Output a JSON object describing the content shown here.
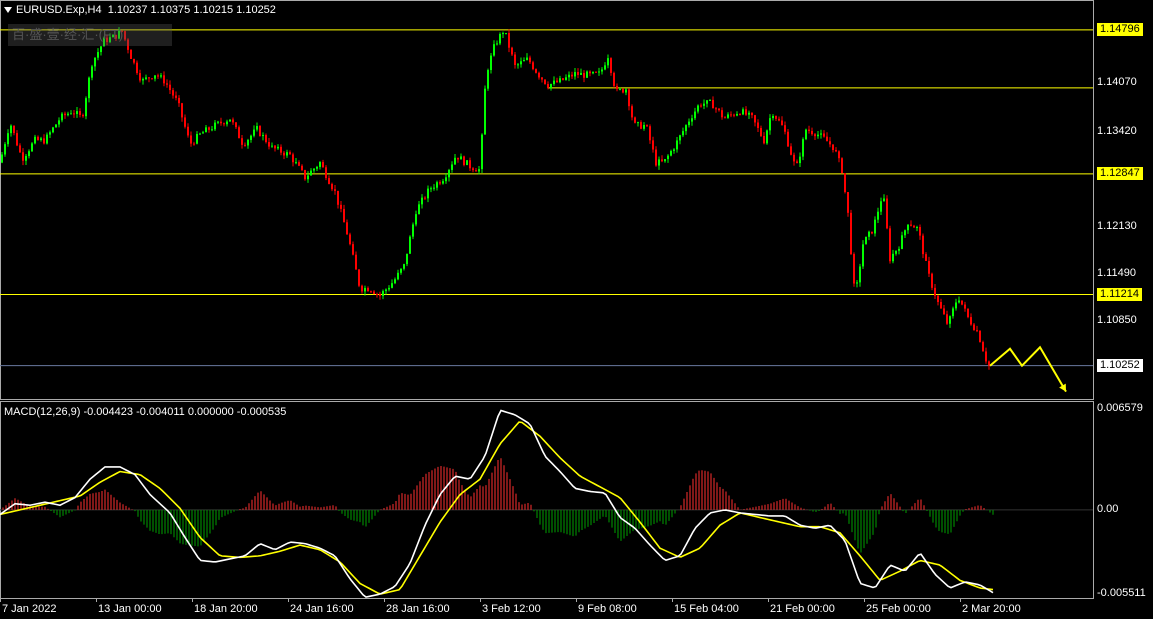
{
  "header": {
    "symbol": "EURUSD.Exp,H4",
    "ohlc": "1.10237 1.10375 1.10215 1.10252",
    "watermark": "百·盛·壹·经·汇·(FT)"
  },
  "macd_header": {
    "text": "MACD(12,26,9) -0.004423 -0.004011 0.000000 -0.000535"
  },
  "colors": {
    "bull": "#00ff00",
    "bear": "#ff0000",
    "level": "#ffff00",
    "macd_line": "#ffffff",
    "signal": "#ffff00",
    "hist_pos": "#ff3030",
    "hist_neg": "#00a000"
  },
  "chart_data": [
    {
      "type": "candlestick",
      "title": "EURUSD.Exp,H4",
      "ylim": [
        1.098,
        1.152
      ],
      "x_ticks": [
        "7 Jan 2022",
        "13 Jan 00:00",
        "18 Jan 20:00",
        "24 Jan 16:00",
        "28 Jan 16:00",
        "3 Feb 12:00",
        "9 Feb 08:00",
        "15 Feb 04:00",
        "21 Feb 00:00",
        "25 Feb 00:00",
        "2 Mar 20:00"
      ],
      "y_ticks": [
        1.1407,
        1.1342,
        1.1213,
        1.1149,
        1.1085
      ],
      "y_tick_labels": [
        "1.14070",
        "1.13420",
        "1.12130",
        "1.11490",
        "1.10850"
      ],
      "levels": [
        {
          "value": 1.14796,
          "label": "1.14796"
        },
        {
          "value": 1.12847,
          "label": "1.12847"
        },
        {
          "value": 1.11214,
          "label": "1.11214"
        }
      ],
      "segment_level": {
        "value": 1.1401
      },
      "current_price": {
        "value": 1.10252,
        "label": "1.10252"
      },
      "path_anchors": [
        [
          0,
          1.13
        ],
        [
          10,
          1.1355
        ],
        [
          22,
          1.1305
        ],
        [
          35,
          1.133
        ],
        [
          45,
          1.133
        ],
        [
          60,
          1.136
        ],
        [
          72,
          1.137
        ],
        [
          82,
          1.136
        ],
        [
          92,
          1.1435
        ],
        [
          104,
          1.1465
        ],
        [
          114,
          1.147
        ],
        [
          122,
          1.1478
        ],
        [
          132,
          1.144
        ],
        [
          142,
          1.141
        ],
        [
          155,
          1.142
        ],
        [
          165,
          1.141
        ],
        [
          178,
          1.138
        ],
        [
          190,
          1.1325
        ],
        [
          202,
          1.134
        ],
        [
          215,
          1.135
        ],
        [
          230,
          1.136
        ],
        [
          243,
          1.1325
        ],
        [
          257,
          1.1345
        ],
        [
          272,
          1.132
        ],
        [
          290,
          1.131
        ],
        [
          305,
          1.128
        ],
        [
          320,
          1.13
        ],
        [
          335,
          1.126
        ],
        [
          348,
          1.12
        ],
        [
          360,
          1.113
        ],
        [
          370,
          1.113
        ],
        [
          380,
          1.112
        ],
        [
          394,
          1.114
        ],
        [
          404,
          1.116
        ],
        [
          416,
          1.1235
        ],
        [
          430,
          1.1265
        ],
        [
          444,
          1.128
        ],
        [
          456,
          1.131
        ],
        [
          470,
          1.1295
        ],
        [
          480,
          1.129
        ],
        [
          486,
          1.142
        ],
        [
          495,
          1.146
        ],
        [
          504,
          1.148
        ],
        [
          515,
          1.143
        ],
        [
          528,
          1.144
        ],
        [
          538,
          1.142
        ],
        [
          548,
          1.1405
        ],
        [
          560,
          1.141
        ],
        [
          575,
          1.142
        ],
        [
          590,
          1.1418
        ],
        [
          600,
          1.142
        ],
        [
          608,
          1.1445
        ],
        [
          616,
          1.1395
        ],
        [
          626,
          1.14
        ],
        [
          634,
          1.135
        ],
        [
          646,
          1.135
        ],
        [
          656,
          1.13
        ],
        [
          664,
          1.13
        ],
        [
          678,
          1.133
        ],
        [
          690,
          1.136
        ],
        [
          700,
          1.138
        ],
        [
          712,
          1.138
        ],
        [
          724,
          1.136
        ],
        [
          740,
          1.137
        ],
        [
          752,
          1.136
        ],
        [
          764,
          1.133
        ],
        [
          772,
          1.137
        ],
        [
          784,
          1.1345
        ],
        [
          796,
          1.129
        ],
        [
          806,
          1.1345
        ],
        [
          816,
          1.134
        ],
        [
          826,
          1.133
        ],
        [
          834,
          1.132
        ],
        [
          842,
          1.129
        ],
        [
          848,
          1.123
        ],
        [
          855,
          1.1115
        ],
        [
          863,
          1.119
        ],
        [
          873,
          1.121
        ],
        [
          883,
          1.126
        ],
        [
          890,
          1.117
        ],
        [
          900,
          1.119
        ],
        [
          908,
          1.122
        ],
        [
          918,
          1.121
        ],
        [
          928,
          1.115
        ],
        [
          938,
          1.111
        ],
        [
          948,
          1.108
        ],
        [
          958,
          1.112
        ],
        [
          968,
          1.109
        ],
        [
          978,
          1.107
        ],
        [
          988,
          1.1025
        ]
      ],
      "projection": [
        [
          990,
          1.1025
        ],
        [
          1010,
          1.1048
        ],
        [
          1022,
          1.1025
        ],
        [
          1040,
          1.105
        ],
        [
          1066,
          1.099
        ]
      ]
    },
    {
      "type": "line",
      "title": "MACD(12,26,9)",
      "ylim": [
        -0.00575,
        0.0071
      ],
      "y_ticks": [
        0.006579,
        0.0,
        -0.005511
      ],
      "y_tick_labels": [
        "0.006579",
        "0.00",
        "-0.005511"
      ],
      "series": [
        {
          "name": "MACD",
          "anchors": [
            [
              0,
              -0.0003
            ],
            [
              15,
              0.0004
            ],
            [
              30,
              0.0003
            ],
            [
              45,
              0.0005
            ],
            [
              60,
              0.0003
            ],
            [
              75,
              0.0008
            ],
            [
              90,
              0.002
            ],
            [
              105,
              0.0028
            ],
            [
              120,
              0.0028
            ],
            [
              135,
              0.0023
            ],
            [
              150,
              0.001
            ],
            [
              170,
              -0.0002
            ],
            [
              185,
              -0.0018
            ],
            [
              200,
              -0.0033
            ],
            [
              215,
              -0.0034
            ],
            [
              230,
              -0.0032
            ],
            [
              245,
              -0.003
            ],
            [
              260,
              -0.0022
            ],
            [
              275,
              -0.0026
            ],
            [
              290,
              -0.0021
            ],
            [
              305,
              -0.0022
            ],
            [
              320,
              -0.0025
            ],
            [
              335,
              -0.003
            ],
            [
              350,
              -0.0045
            ],
            [
              365,
              -0.0057
            ],
            [
              380,
              -0.0055
            ],
            [
              395,
              -0.005
            ],
            [
              410,
              -0.0035
            ],
            [
              425,
              -0.001
            ],
            [
              440,
              0.001
            ],
            [
              455,
              0.0022
            ],
            [
              470,
              0.002
            ],
            [
              485,
              0.0035
            ],
            [
              500,
              0.0065
            ],
            [
              515,
              0.0062
            ],
            [
              530,
              0.0056
            ],
            [
              545,
              0.0035
            ],
            [
              560,
              0.0025
            ],
            [
              575,
              0.0014
            ],
            [
              590,
              0.0012
            ],
            [
              605,
              0.0011
            ],
            [
              620,
              -0.0005
            ],
            [
              635,
              -0.0012
            ],
            [
              650,
              -0.0023
            ],
            [
              665,
              -0.0033
            ],
            [
              680,
              -0.003
            ],
            [
              695,
              -0.0012
            ],
            [
              710,
              -0.0002
            ],
            [
              725,
              0.0
            ],
            [
              740,
              -0.0002
            ],
            [
              755,
              -0.0003
            ],
            [
              770,
              -0.0004
            ],
            [
              785,
              -0.0004
            ],
            [
              800,
              -0.001
            ],
            [
              815,
              -0.0012
            ],
            [
              830,
              -0.001
            ],
            [
              845,
              -0.002
            ],
            [
              860,
              -0.0048
            ],
            [
              875,
              -0.0051
            ],
            [
              890,
              -0.0036
            ],
            [
              905,
              -0.004
            ],
            [
              920,
              -0.0028
            ],
            [
              935,
              -0.0042
            ],
            [
              950,
              -0.0051
            ],
            [
              965,
              -0.0047
            ],
            [
              980,
              -0.0049
            ],
            [
              993,
              -0.0054
            ]
          ]
        },
        {
          "name": "Signal",
          "anchors": [
            [
              0,
              -0.0003
            ],
            [
              20,
              0.0
            ],
            [
              40,
              0.0003
            ],
            [
              60,
              0.0006
            ],
            [
              80,
              0.0009
            ],
            [
              100,
              0.0018
            ],
            [
              120,
              0.0025
            ],
            [
              140,
              0.0023
            ],
            [
              160,
              0.0014
            ],
            [
              180,
              0.0001
            ],
            [
              200,
              -0.0018
            ],
            [
              220,
              -0.003
            ],
            [
              240,
              -0.0031
            ],
            [
              260,
              -0.003
            ],
            [
              280,
              -0.0027
            ],
            [
              300,
              -0.0023
            ],
            [
              320,
              -0.0026
            ],
            [
              340,
              -0.0034
            ],
            [
              360,
              -0.0048
            ],
            [
              380,
              -0.0055
            ],
            [
              400,
              -0.0052
            ],
            [
              420,
              -0.003
            ],
            [
              440,
              -0.0008
            ],
            [
              460,
              0.001
            ],
            [
              480,
              0.002
            ],
            [
              500,
              0.0043
            ],
            [
              520,
              0.0058
            ],
            [
              540,
              0.0048
            ],
            [
              560,
              0.0034
            ],
            [
              580,
              0.0022
            ],
            [
              600,
              0.0015
            ],
            [
              620,
              0.0008
            ],
            [
              640,
              -0.0008
            ],
            [
              660,
              -0.0025
            ],
            [
              680,
              -0.0031
            ],
            [
              700,
              -0.0025
            ],
            [
              720,
              -0.001
            ],
            [
              740,
              -0.0002
            ],
            [
              760,
              -0.0005
            ],
            [
              780,
              -0.0008
            ],
            [
              800,
              -0.0011
            ],
            [
              820,
              -0.0011
            ],
            [
              840,
              -0.0015
            ],
            [
              860,
              -0.003
            ],
            [
              880,
              -0.0046
            ],
            [
              900,
              -0.004
            ],
            [
              920,
              -0.0033
            ],
            [
              940,
              -0.0036
            ],
            [
              960,
              -0.0046
            ],
            [
              980,
              -0.0051
            ],
            [
              993,
              -0.0052
            ]
          ]
        }
      ]
    }
  ]
}
